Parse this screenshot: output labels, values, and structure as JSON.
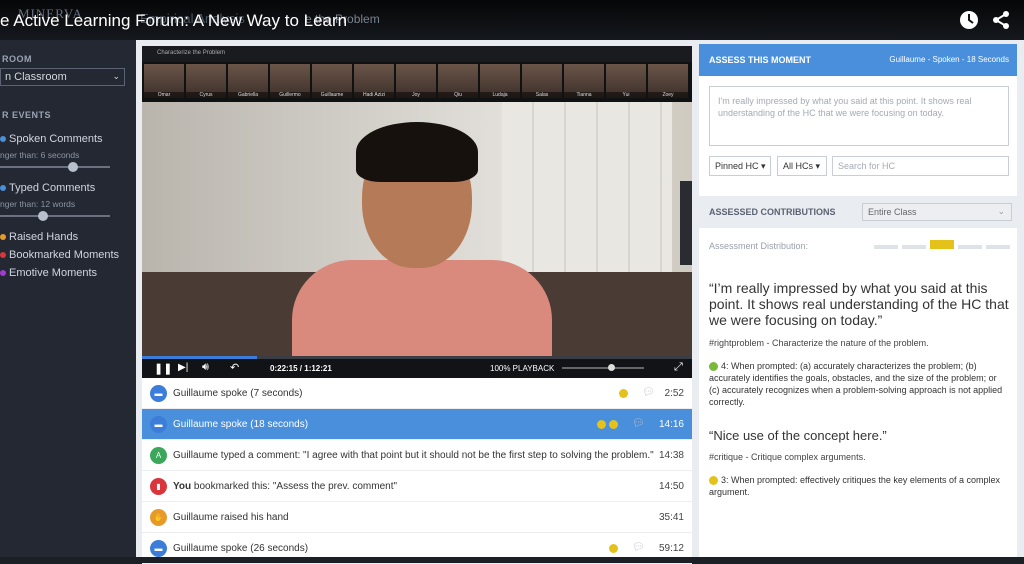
{
  "topbar": {
    "title": "e Active Learning Forum: A New Way to Learn",
    "ghost_brand": "MINERVA",
    "ghost_crumb": "Empirical Analysis",
    "ghost_crumb2": "e the Problem"
  },
  "sidebar": {
    "room_heading": "ROOM",
    "room_select": "n Classroom",
    "events_heading": "R EVENTS",
    "events": [
      {
        "label": "Spoken Comments",
        "color": "#4a8fdb"
      },
      {
        "label": "Typed Comments",
        "color": "#4a8fdb"
      },
      {
        "label": "Raised Hands",
        "color": "#e59a2a"
      },
      {
        "label": "Bookmarked Moments",
        "color": "#d9353b"
      },
      {
        "label": "Emotive Moments",
        "color": "#a13bd1"
      }
    ],
    "spoken_filter": "nger than: 6 seconds",
    "typed_filter": "nger than: 12 words"
  },
  "video": {
    "header": "Characterize the Problem",
    "participants": [
      "Omar",
      "Cyrus",
      "Gabriella",
      "Guillermo",
      "Guillaume",
      "Hadi Azizi",
      "Joy",
      "Qiu",
      "Ludaja",
      "Salas",
      "Tianna",
      "Yui",
      "Zoey"
    ],
    "time": "0:22:15 / 1:12:21",
    "playback": "100% PLAYBACK"
  },
  "events_list": [
    {
      "icon": "speech",
      "color": "#3b7dd8",
      "text": "Guillaume spoke  (7 seconds)",
      "time": "2:52",
      "marks": 1
    },
    {
      "icon": "speech",
      "color": "#3b7dd8",
      "text": "Guillaume spoke  (18 seconds)",
      "time": "14:16",
      "marks": 2,
      "selected": true
    },
    {
      "icon": "A",
      "color": "#3aa75a",
      "text": "Guillaume typed a comment: \"I agree with that point but it should not be the first step to solving the problem.\"",
      "time": "14:38",
      "marks": 0
    },
    {
      "icon": "bookmark",
      "color": "#d9353b",
      "prefix": "You",
      "text": " bookmarked this: \"Assess the prev. comment\"",
      "time": "14:50",
      "marks": 0
    },
    {
      "icon": "hand",
      "color": "#e59a2a",
      "text": "Guillaume raised his hand",
      "time": "35:41",
      "marks": 0
    },
    {
      "icon": "speech",
      "color": "#3b7dd8",
      "text": "Guillaume spoke  (26 seconds)",
      "time": "59:12",
      "marks": 1
    }
  ],
  "assess": {
    "title": "ASSESS THIS MOMENT",
    "meta": "Guillaume  - Spoken - 18 Seconds",
    "comment_placeholder": "I'm really impressed by what you said at this point. It shows real understanding of the HC that we were focusing on today.",
    "pinned": "Pinned HC",
    "all_hcs": "All HCs",
    "search_placeholder": "Search for HC"
  },
  "contributions": {
    "title": "ASSESSED CONTRIBUTIONS",
    "filter": "Entire Class",
    "distribution_label": "Assessment Distribution:",
    "items": [
      {
        "quote": "“I’m really impressed by what you said at this point. It shows real understanding of the HC that we were focusing on today.”",
        "tag": "#rightproblem - Characterize the nature of the problem.",
        "score": "4: When prompted: (a) accurately characterizes the problem; (b) accurately identifies the goals, obstacles, and the size of the problem; or (c) accurately recognizes when a problem-solving approach is not applied correctly.",
        "score_color": "#7ab83a"
      },
      {
        "quote": "“Nice use of the concept here.”",
        "tag": "#critique - Critique complex arguments.",
        "score": "3: When prompted: effectively critiques the key elements of a complex argument.",
        "score_color": "#e5c21a"
      }
    ]
  }
}
